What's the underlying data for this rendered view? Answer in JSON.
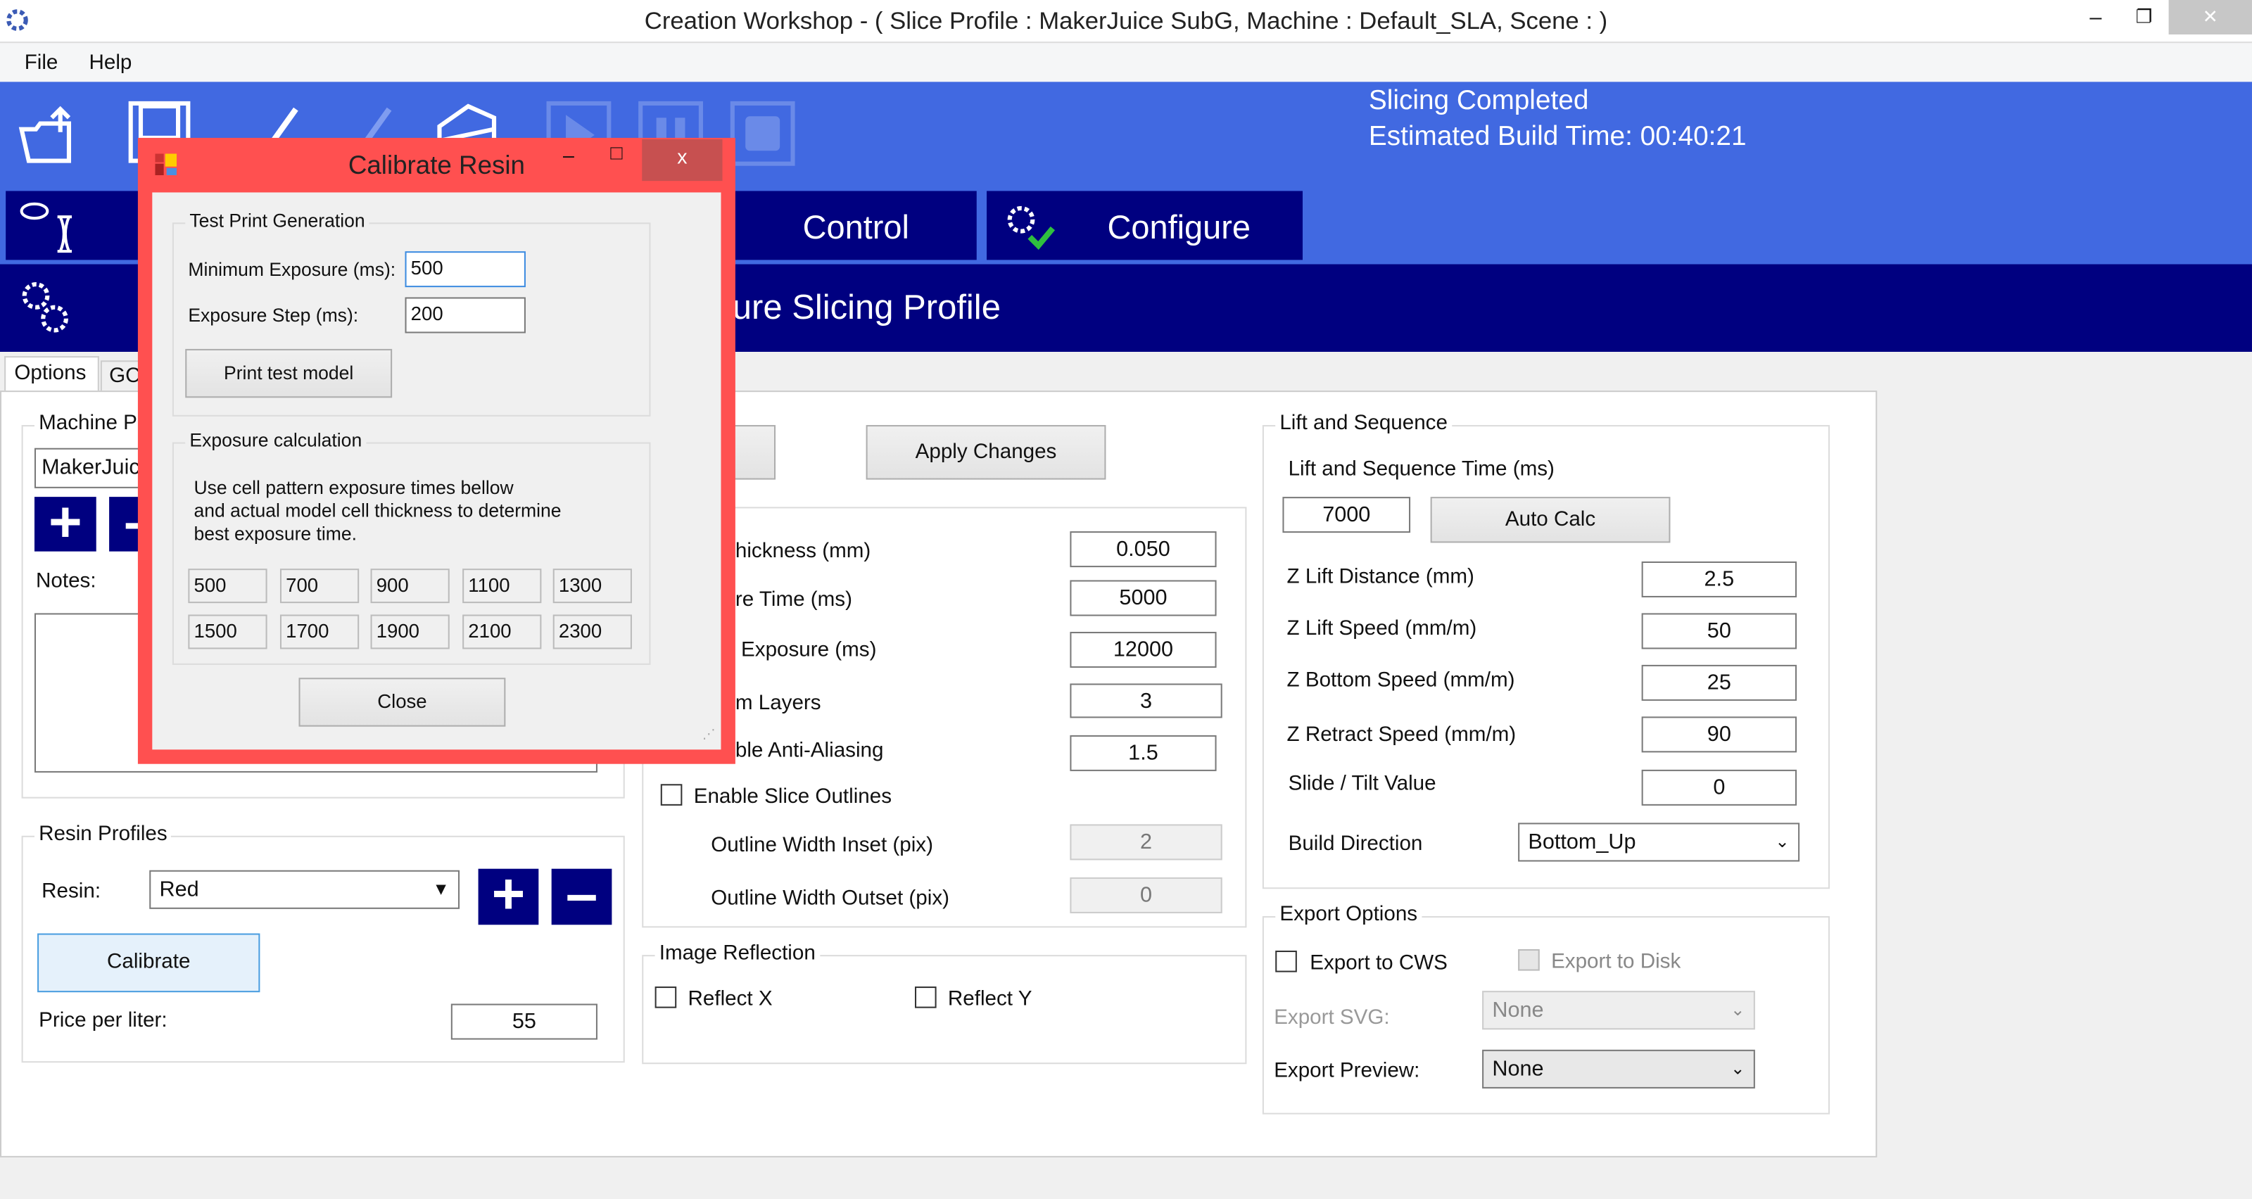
{
  "window": {
    "title": "Creation Workshop -   ( Slice Profile : MakerJuice SubG, Machine : Default_SLA, Scene : )",
    "controls": {
      "minimize": "–",
      "restore": "❐",
      "close": "✕"
    }
  },
  "menu": [
    {
      "label": "File"
    },
    {
      "label": "Help"
    }
  ],
  "toolbar": {
    "icons": [
      "open-folder-icon",
      "save-icon",
      "brush-icon",
      "brush-disabled-icon",
      "slice-icon",
      "play-icon",
      "pause-icon",
      "stop-icon"
    ],
    "accent": "#4169e1"
  },
  "status": {
    "line1": "Slicing Completed",
    "line2": "Estimated Build Time: 00:40:21"
  },
  "main_tabs": [
    {
      "label": "Control"
    },
    {
      "label": "Configure"
    }
  ],
  "header": {
    "title": "Configure Slicing Profile",
    "visible_fragment": "ure Slicing Profile",
    "color": "#000080"
  },
  "sub_tabs": [
    {
      "label": "Options",
      "selected": true
    },
    {
      "label": "GC"
    }
  ],
  "machine_profiles": {
    "title": "Machine P",
    "selected": "MakerJuic",
    "add": "+",
    "remove": "–",
    "notes_label": "Notes:",
    "notes": ""
  },
  "resin_profiles": {
    "title": "Resin Profiles",
    "resin_label": "Resin:",
    "resin_value": "Red",
    "add": "+",
    "remove": "–",
    "calibrate": "Calibrate",
    "price_label": "Price per liter:",
    "price_value": "55"
  },
  "slicing": {
    "apply": "Apply Changes",
    "rows": [
      {
        "label": "hickness (mm)",
        "value": "0.050"
      },
      {
        "label": "re Time (ms)",
        "value": "5000"
      },
      {
        "label": "Exposure (ms)",
        "value": "12000"
      },
      {
        "label": "m Layers",
        "value": "3"
      },
      {
        "label": "ble Anti-Aliasing",
        "value": "1.5"
      }
    ],
    "slice_outlines": {
      "label": "Enable Slice Outlines",
      "checked": false
    },
    "inset": {
      "label": "Outline Width Inset (pix)",
      "value": "2"
    },
    "outset": {
      "label": "Outline Width Outset (pix)",
      "value": "0"
    }
  },
  "reflection": {
    "title": "Image Reflection",
    "x": {
      "label": "Reflect X",
      "checked": false
    },
    "y": {
      "label": "Reflect Y",
      "checked": false
    }
  },
  "lift": {
    "title": "Lift and Sequence",
    "time_label": "Lift and Sequence Time (ms)",
    "time_value": "7000",
    "auto_calc": "Auto Calc",
    "rows": [
      {
        "label": "Z Lift Distance (mm)",
        "value": "2.5"
      },
      {
        "label": "Z Lift Speed (mm/m)",
        "value": "50"
      },
      {
        "label": "Z Bottom Speed (mm/m)",
        "value": "25"
      },
      {
        "label": "Z Retract Speed (mm/m)",
        "value": "90"
      },
      {
        "label": "Slide / Tilt Value",
        "value": "0"
      }
    ],
    "build_direction_label": "Build Direction",
    "build_direction": "Bottom_Up"
  },
  "export": {
    "title": "Export Options",
    "cws": {
      "label": "Export to CWS",
      "checked": false
    },
    "disk": {
      "label": "Export to Disk",
      "checked": false,
      "disabled": true
    },
    "svg_label": "Export SVG:",
    "svg_value": "None",
    "preview_label": "Export Preview:",
    "preview_value": "None"
  },
  "dialog": {
    "title": "Calibrate Resin",
    "accent": "#ff5050",
    "controls": {
      "minimize": "–",
      "maximize": "□",
      "close": "x"
    },
    "test_print": {
      "title": "Test Print Generation",
      "min_label": "Minimum Exposure (ms):",
      "min_value": "500",
      "step_label": "Exposure Step (ms):",
      "step_value": "200",
      "print_button": "Print test model"
    },
    "calc": {
      "title": "Exposure calculation",
      "text": [
        "Use cell pattern exposure times bellow",
        "and actual model cell thickness to determine",
        "best exposure time."
      ],
      "cells": [
        [
          "500",
          "700",
          "900",
          "1100",
          "1300"
        ],
        [
          "1500",
          "1700",
          "1900",
          "2100",
          "2300"
        ]
      ]
    },
    "close": "Close"
  }
}
